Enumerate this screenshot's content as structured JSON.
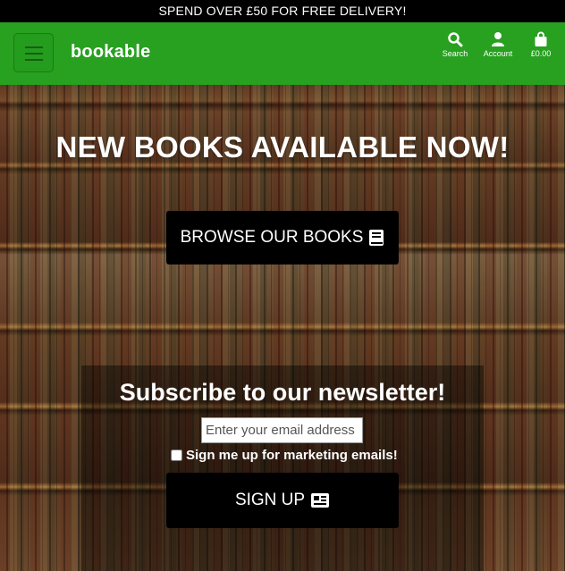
{
  "promo_banner": "SPEND OVER £50 FOR FREE DELIVERY!",
  "brand": {
    "logo_text": "bookable",
    "color": "#28a020"
  },
  "nav": {
    "search_label": "Search",
    "account_label": "Account",
    "basket_total": "£0.00"
  },
  "hero": {
    "headline": "NEW BOOKS AVAILABLE NOW!",
    "browse_label": "BROWSE OUR BOOKS"
  },
  "newsletter": {
    "title": "Subscribe to our newsletter!",
    "email_placeholder": "Enter your email address",
    "consent_label": "Sign me up for marketing emails!",
    "signup_label": "SIGN UP"
  },
  "icons": {
    "menu": "hamburger-icon",
    "search": "search-icon",
    "account": "user-icon",
    "basket": "shopping-bag-icon",
    "browse": "book-icon",
    "signup": "newspaper-icon"
  }
}
